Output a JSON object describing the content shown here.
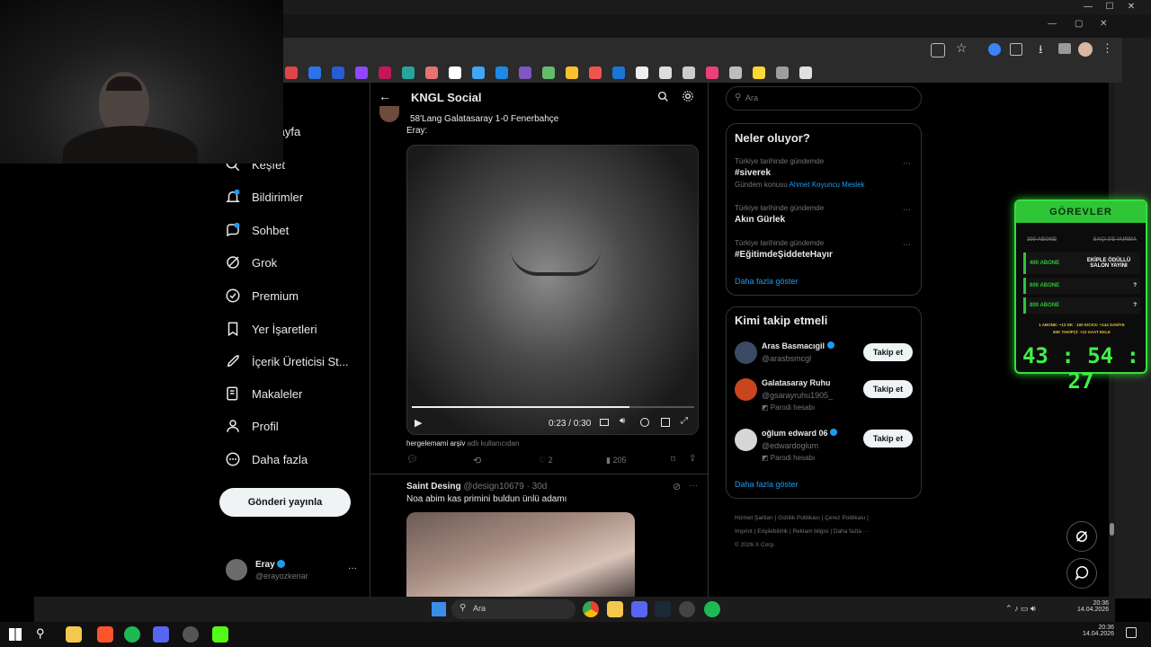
{
  "window_controls": {
    "minimize": "—",
    "maximize": "☐",
    "close": "✕"
  },
  "browser_controls": {
    "minimize": "—",
    "maximize": "▢",
    "close": "✕"
  },
  "sidebar": {
    "items": [
      {
        "label": "Anasayfa",
        "icon": "home-icon"
      },
      {
        "label": "Keşfet",
        "icon": "search-icon"
      },
      {
        "label": "Bildirimler",
        "icon": "bell-icon"
      },
      {
        "label": "Sohbet",
        "icon": "chat-icon"
      },
      {
        "label": "Grok",
        "icon": "grok-icon"
      },
      {
        "label": "Premium",
        "icon": "premium-icon"
      },
      {
        "label": "Yer İşaretleri",
        "icon": "bookmark-icon"
      },
      {
        "label": "İçerik Üreticisi St...",
        "icon": "rocket-icon"
      },
      {
        "label": "Makaleler",
        "icon": "article-icon"
      },
      {
        "label": "Profil",
        "icon": "profile-icon"
      },
      {
        "label": "Daha fazla",
        "icon": "more-icon"
      }
    ],
    "post_button": "Gönderi yayınla",
    "account": {
      "name": "Eray",
      "handle": "@erayozkenar",
      "menu": "···"
    }
  },
  "header": {
    "title": "KNGL Social"
  },
  "tweet1": {
    "text": "58'Lang Galatasaray 1-0 Fenerbahçe",
    "text2": "Eray:",
    "video": {
      "time": "0:23 / 0:30",
      "progress": 0.77
    },
    "source_user": "hergelemami arşiv",
    "source_suffix": "adlı kullanıcıdan",
    "likes": "2",
    "views": "205"
  },
  "tweet2": {
    "name": "Saint Desing",
    "handle": "@design10679",
    "time": "· 30d",
    "text": "Noa abim kas primini buldun ünlü adamı"
  },
  "right": {
    "search_placeholder": "Ara",
    "trends_title": "Neler oluyor?",
    "trends": [
      {
        "context": "Türkiye tarihinde gündemde",
        "title": "#siverek",
        "sub_label": "Gündem konusu",
        "sub_link": "Ahmet Koyuncu Meslek"
      },
      {
        "context": "Türkiye tarihinde gündemde",
        "title": "Akın Gürlek"
      },
      {
        "context": "Türkiye tarihinde gündemde",
        "title": "#EğitimdeŞiddeteHayır"
      }
    ],
    "trends_more": "Daha fazla göster",
    "follow_title": "Kimi takip etmeli",
    "follow": [
      {
        "name": "Aras Basmacıgil",
        "handle": "@arasbsmcgl",
        "label": "",
        "button": "Takip et"
      },
      {
        "name": "Galatasaray Ruhu",
        "handle": "@gsarayruhu1905_",
        "label": "Parodi hesabı",
        "button": "Takip et"
      },
      {
        "name": "oğlum edward 06",
        "handle": "@edwardoglum",
        "label": "Parodi hesabı",
        "button": "Takip et"
      }
    ],
    "follow_more": "Daha fazla göster",
    "footer": [
      "Hizmet Şartları",
      "Gizlilik Politikası",
      "Çerez Politikası",
      "Imprint",
      "Erişilebilirlik",
      "Reklam bilgisi",
      "Daha fazla ···",
      "© 2026 X Corp."
    ]
  },
  "quests": {
    "title": "GÖREVLER",
    "rows": [
      {
        "left": "200 ABONE",
        "right": "SAÇI 3'E VURMA"
      },
      {
        "left": "400 ABONE",
        "right": "EKİPLE ÖDÜLLÜ SALON YAYINI"
      },
      {
        "left": "600 ABONE",
        "right": "?"
      },
      {
        "left": "800 ABONE",
        "right": "?"
      }
    ],
    "note_line1": "1 ABONE: +13 DK · 100 KICKS: +144 SANİYE",
    "note_line2": "60K TAKİPÇİ: +12 SAAT EKLE",
    "timer": "43 : 54 : 27"
  },
  "taskbar_search": "Ara",
  "clock": {
    "time": "20:36",
    "date": "14.04.2026"
  },
  "colors": {
    "accent": "#1d9bf0",
    "quest_green": "#33e03a",
    "verified": "#1d9bf0"
  }
}
